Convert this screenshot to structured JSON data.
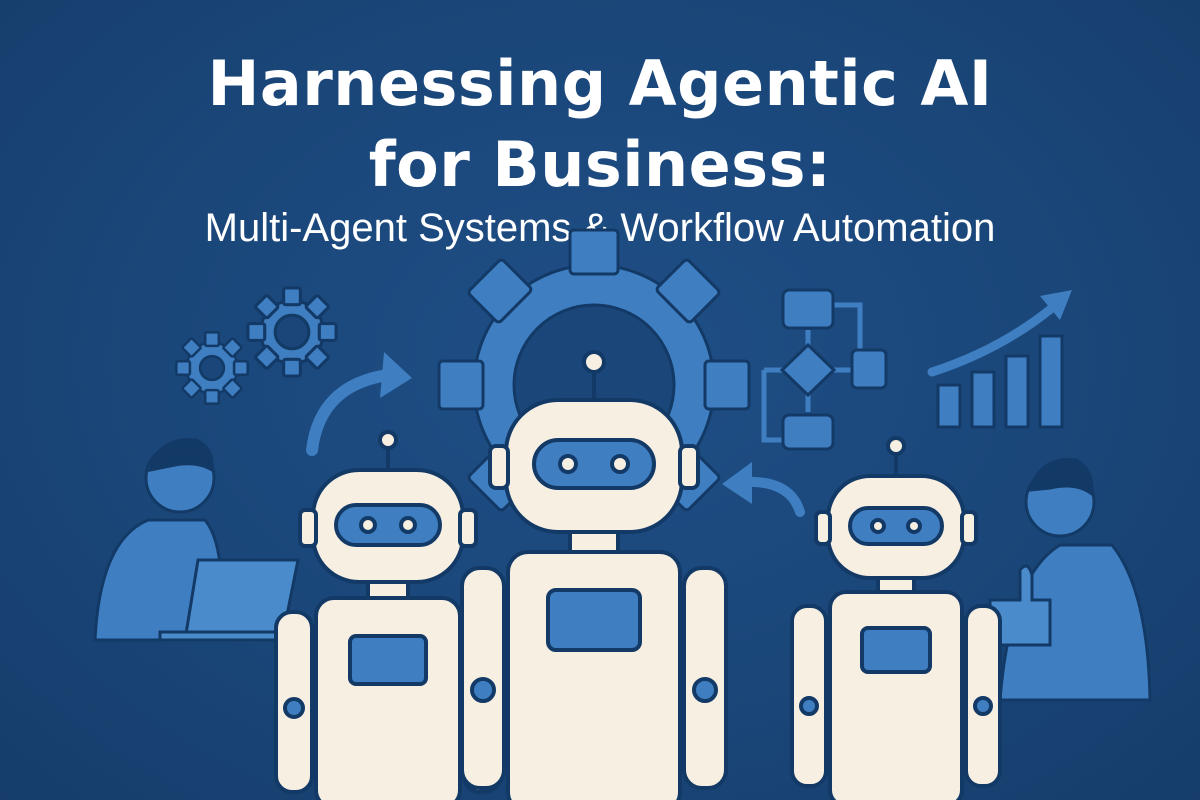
{
  "header": {
    "title_line1": "Harnessing Agentic AI",
    "title_line2": "for Business:",
    "subtitle": "Multi-Agent Systems & Workflow Automation"
  },
  "colors": {
    "background": "#1a4679",
    "accent_blue": "#3f7fc1",
    "robot_body": "#f7efe2",
    "robot_outline": "#133a66",
    "text": "#ffffff"
  },
  "icons": [
    "gears-icon",
    "curved-arrow-icon",
    "gear-icon",
    "flowchart-icon",
    "growth-chart-icon",
    "person-laptop-icon",
    "person-thumbs-up-icon",
    "robot-icon"
  ]
}
